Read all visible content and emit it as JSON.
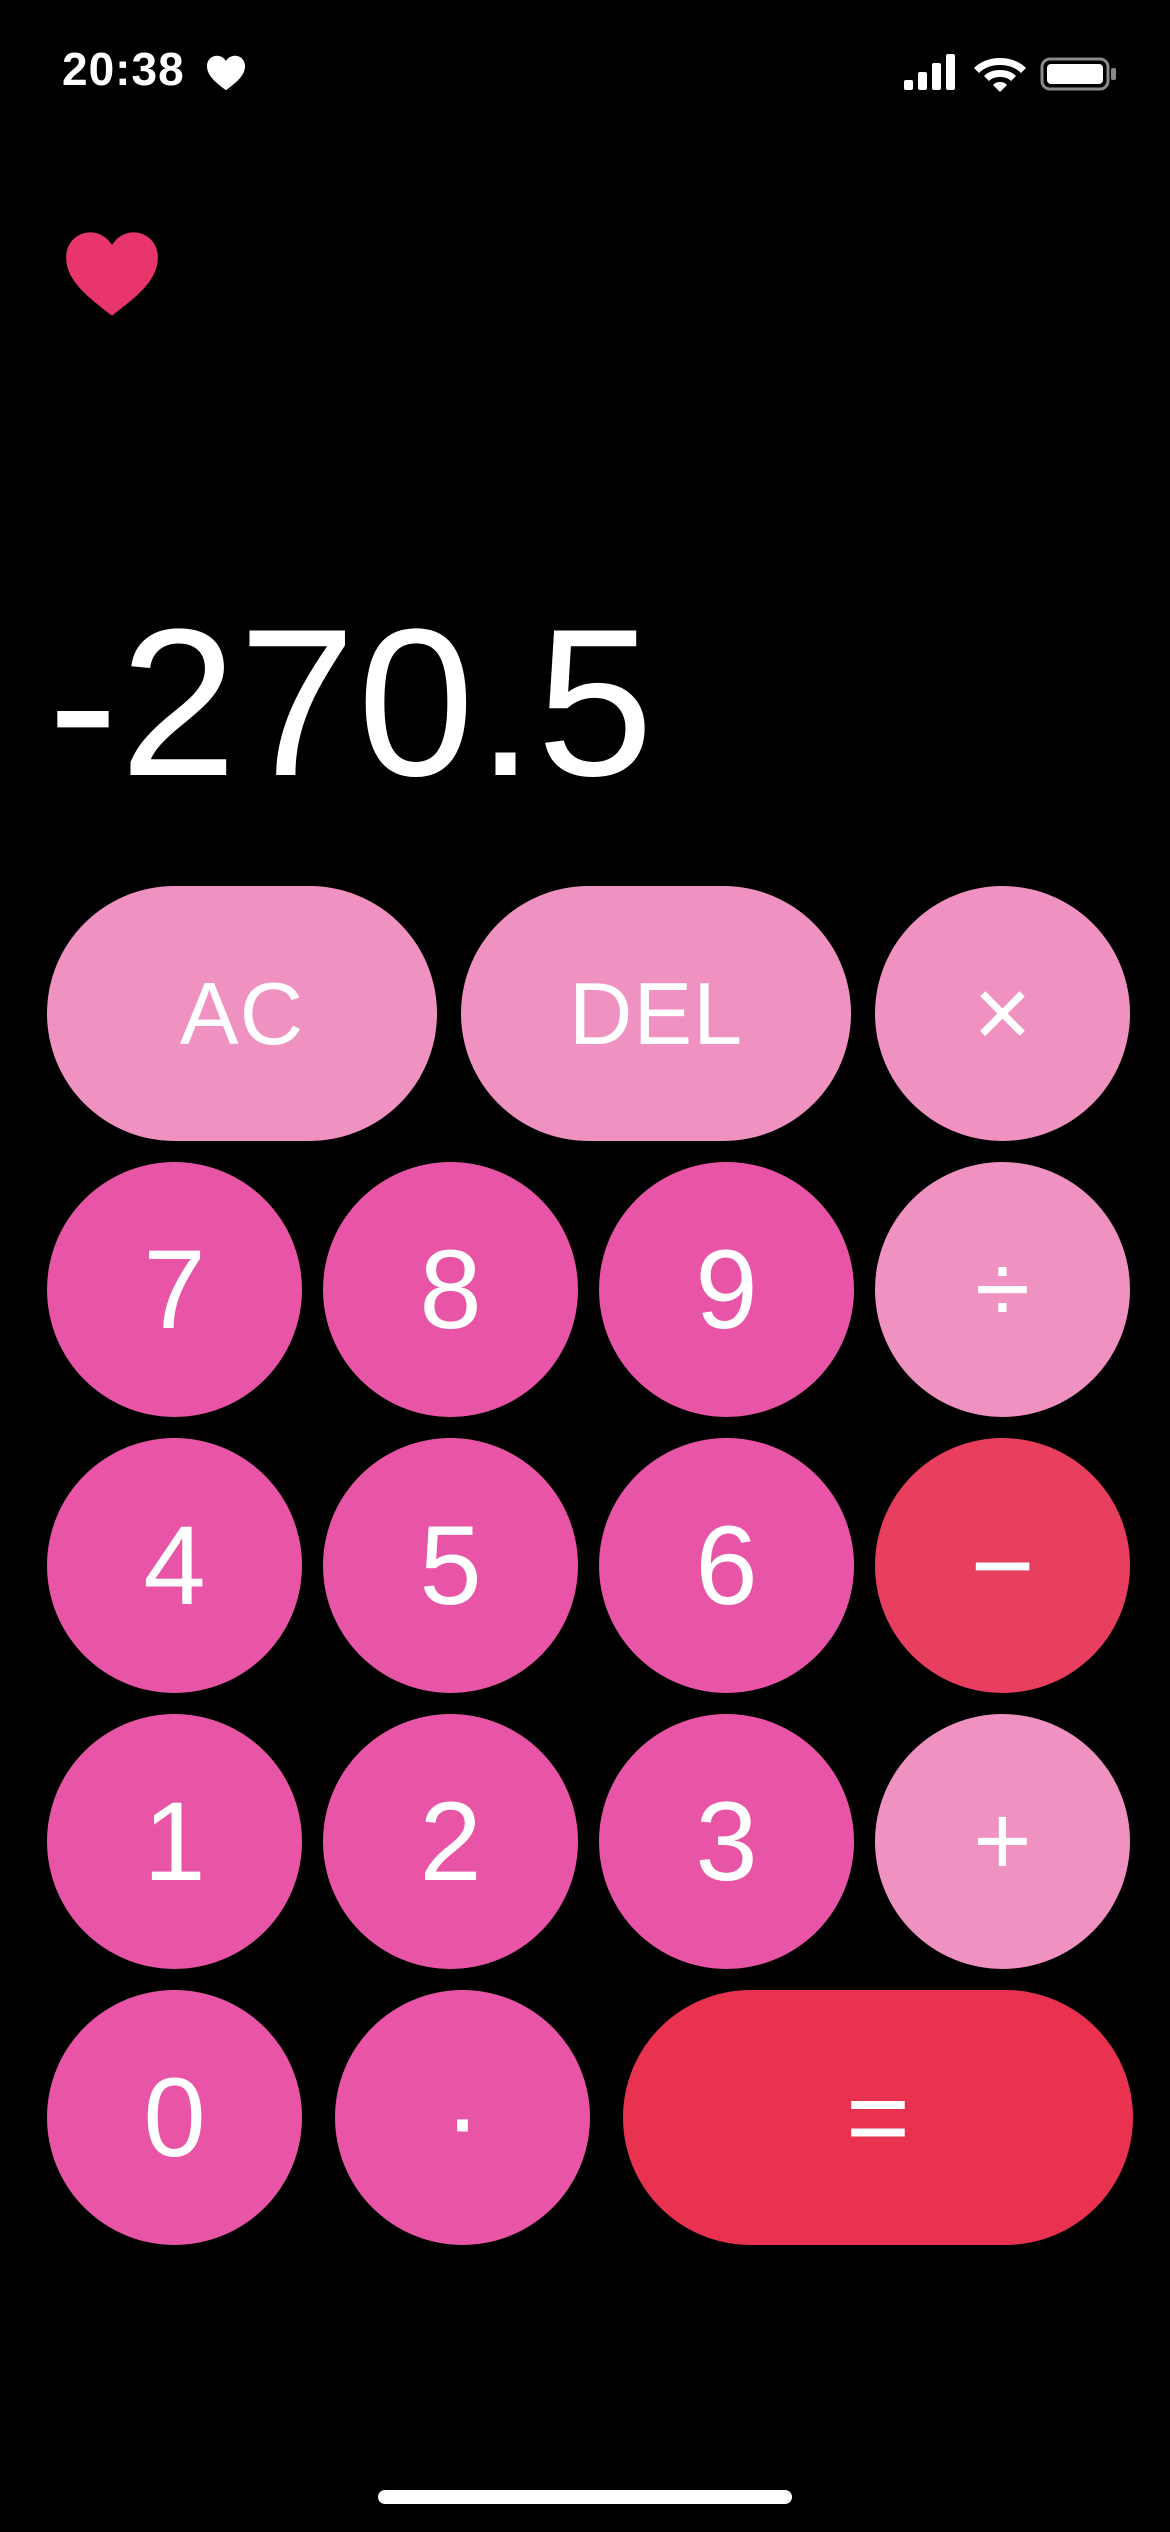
{
  "status_bar": {
    "time": "20:38",
    "icons": [
      "heart-icon",
      "signal-icon",
      "wifi-icon",
      "battery-icon"
    ]
  },
  "display": {
    "value": "-270.5"
  },
  "keys": {
    "ac": "AC",
    "del": "DEL",
    "multiply": "×",
    "divide": "÷",
    "minus": "−",
    "plus": "+",
    "equals": "=",
    "decimal": "·",
    "digits": [
      "0",
      "1",
      "2",
      "3",
      "4",
      "5",
      "6",
      "7",
      "8",
      "9"
    ]
  },
  "colors": {
    "background": "#000000",
    "digit_key": "#e955a6",
    "operator_key": "#ef92c2",
    "minus_key": "#e83f5f",
    "equals_key": "#e8324f",
    "heart": "#e8366d"
  }
}
